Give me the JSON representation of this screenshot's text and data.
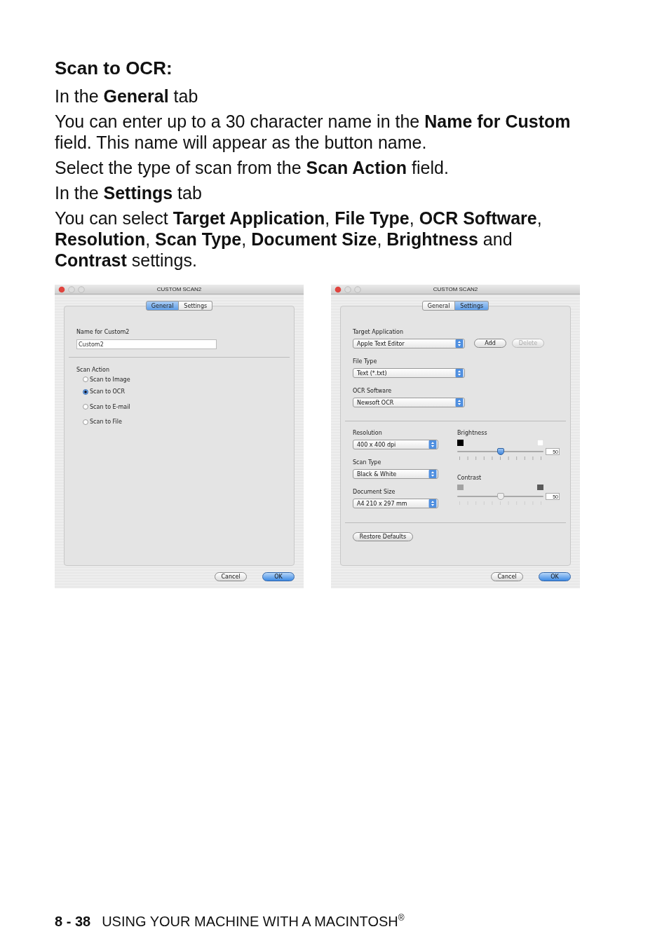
{
  "heading": "Scan to OCR:",
  "paragraphs": [
    "In the **General** tab",
    "You can enter up to a 30 character name in the **Name for Custom** field. This name will appear as the button name.",
    "Select the type of scan from the **Scan Action** field.",
    "In the **Settings** tab",
    "You can select **Target Application**, **File Type**, **OCR Software**, **Resolution**, **Scan Type**, **Document Size**, **Brightness** and **Contrast** settings."
  ],
  "dialogs": [
    {
      "kind": "general",
      "title": "CUSTOM SCAN2",
      "tabs": [
        {
          "label": "General",
          "selected": true
        },
        {
          "label": "Settings",
          "selected": false
        }
      ],
      "name_field": {
        "label": "Name for Custom2",
        "value": "Custom2"
      },
      "scan_action": {
        "label": "Scan Action",
        "options": [
          {
            "label": "Scan to Image",
            "selected": false
          },
          {
            "label": "Scan to OCR",
            "selected": true
          },
          {
            "label": "Scan to E-mail",
            "selected": false
          },
          {
            "label": "Scan to File",
            "selected": false
          }
        ]
      },
      "cancel": "Cancel",
      "ok": "OK"
    },
    {
      "kind": "settings",
      "title": "CUSTOM SCAN2",
      "tabs": [
        {
          "label": "General",
          "selected": false
        },
        {
          "label": "Settings",
          "selected": true
        }
      ],
      "target_application": {
        "label": "Target Application",
        "value": "Apple Text Editor"
      },
      "add_button": {
        "label": "Add",
        "disabled": false
      },
      "delete_button": {
        "label": "Delete",
        "disabled": true
      },
      "file_type": {
        "label": "File Type",
        "value": "Text (*.txt)"
      },
      "ocr_software": {
        "label": "OCR Software",
        "value": "Newsoft OCR"
      },
      "resolution": {
        "label": "Resolution",
        "value": "400 x 400 dpi"
      },
      "scan_type": {
        "label": "Scan Type",
        "value": "Black & White"
      },
      "document_size": {
        "label": "Document Size",
        "value": "A4 210 x 297 mm"
      },
      "brightness": {
        "label": "Brightness",
        "level": 0.5,
        "reading": "50",
        "disabled": false
      },
      "contrast": {
        "label": "Contrast",
        "level": 0.5,
        "reading": "50",
        "disabled": true
      },
      "restore_defaults": "Restore Defaults",
      "cancel": "Cancel",
      "ok": "OK"
    }
  ],
  "footer": {
    "page": "8 - 38",
    "title": "USING YOUR MACHINE WITH A MACINTOSH$^{®}$"
  }
}
